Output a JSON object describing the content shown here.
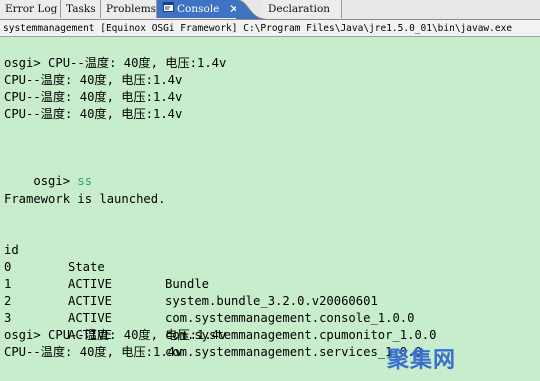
{
  "tabs": [
    {
      "label": "Error Log"
    },
    {
      "label": "Tasks"
    },
    {
      "label": "Problems"
    },
    {
      "label": "Console",
      "active": true
    },
    {
      "label": "Declaration"
    }
  ],
  "path_line": "systemmanagement [Equinox OSGi Framework] C:\\Program Files\\Java\\jre1.5.0_01\\bin\\javaw.exe",
  "console": {
    "lines_top": [
      "osgi> CPU--温度: 40度, 电压:1.4v",
      "CPU--温度: 40度, 电压:1.4v",
      "CPU--温度: 40度, 电压:1.4v",
      "CPU--温度: 40度, 电压:1.4v"
    ],
    "prompt": "osgi> ",
    "command": "ss",
    "launched": "Framework is launched.",
    "headers": {
      "id": "id",
      "state": "State",
      "bundle": "Bundle"
    },
    "rows": [
      {
        "id": "0",
        "state": "ACTIVE",
        "bundle": "system.bundle_3.2.0.v20060601"
      },
      {
        "id": "1",
        "state": "ACTIVE",
        "bundle": "com.systemmanagement.console_1.0.0"
      },
      {
        "id": "2",
        "state": "ACTIVE",
        "bundle": "com.systemmanagement.cpumonitor_1.0.0"
      },
      {
        "id": "3",
        "state": "ACTIVE",
        "bundle": "com.systemmanagement.services_1.0.0"
      }
    ],
    "lines_bottom": [
      "osgi> CPU--温度: 40度, 电压:1.4v",
      "CPU--温度: 40度, 电压:1.4v"
    ]
  },
  "watermark": "聚集网"
}
